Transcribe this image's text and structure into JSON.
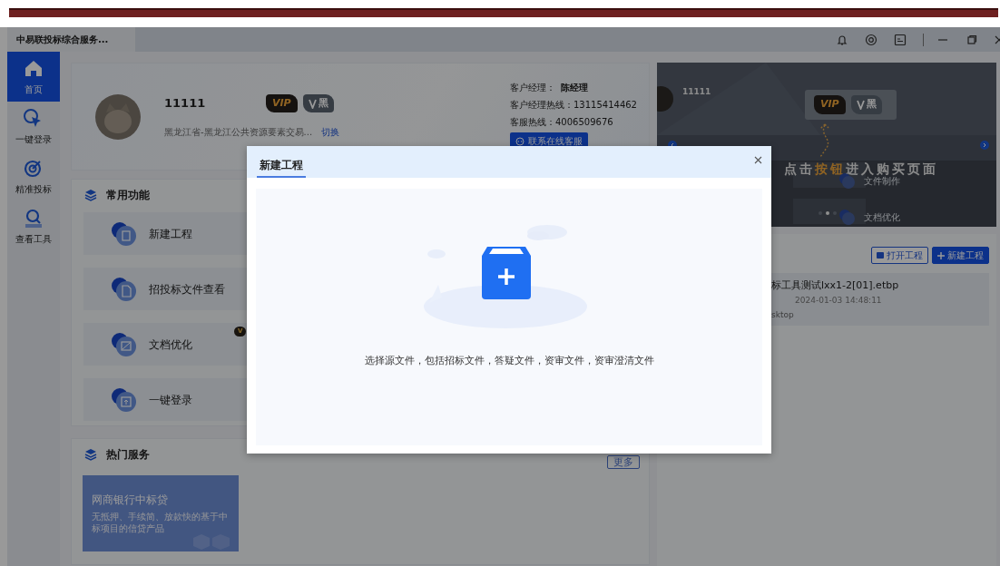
{
  "window": {
    "title": "中易联投标综合服务..."
  },
  "sidebar": {
    "items": [
      {
        "label": "首页",
        "selected": true,
        "kind": "home"
      },
      {
        "label": "一键登录",
        "selected": false,
        "kind": "login"
      },
      {
        "label": "精准投标",
        "selected": false,
        "kind": "target"
      },
      {
        "label": "查看工具",
        "selected": false,
        "kind": "search"
      }
    ]
  },
  "profile": {
    "name": "11111",
    "org": "黑龙江省-黑龙江公共资源要素交易...",
    "switch_link": "切换",
    "badges": [
      {
        "label": "VIP",
        "kind": "vip"
      },
      {
        "label": "黑",
        "kind": "level"
      }
    ],
    "manager_label": "客户经理：",
    "manager_name": "陈经理",
    "manager_hotline": "客户经理热线：13115414462",
    "service_hotline": "客服热线：4006509676",
    "chat_button": "联系在线客服"
  },
  "common": {
    "title": "常用功能",
    "items": [
      {
        "label": "新建工程",
        "kind": "project"
      },
      {
        "label": "招投标文件查看",
        "kind": "view"
      },
      {
        "label": "文档优化",
        "kind": "optimize",
        "badge": "V"
      },
      {
        "label": "一键登录",
        "kind": "login"
      }
    ]
  },
  "hot": {
    "title": "热门服务",
    "more": "更多",
    "promo": {
      "title": "网商银行中标贷",
      "text": "无抵押、手续简、放款快的基于中标项目的信贷产品"
    }
  },
  "banner": {
    "name": "11111",
    "badges": [
      {
        "label": "VIP",
        "kind": "vip"
      },
      {
        "label": "黑",
        "kind": "level"
      }
    ],
    "caption": [
      {
        "text": "点击",
        "highlight": false
      },
      {
        "text": "按钮",
        "highlight": true
      },
      {
        "text": "进入购买页面",
        "highlight": false
      }
    ],
    "items": [
      "文件制作",
      "文档优化"
    ],
    "slides": [
      {
        "selected": false
      },
      {
        "selected": true
      },
      {
        "selected": false
      }
    ]
  },
  "recent": {
    "buttons": [
      {
        "label": "打开工程",
        "kind": "outline"
      },
      {
        "label": "新建工程",
        "kind": "primary"
      }
    ],
    "files": [
      {
        "name": "标工具测试lxx1-2[01].etbp",
        "time": "2024-01-03 14:48:11",
        "path": "sktop"
      }
    ]
  },
  "dialog": {
    "tab": "新建工程",
    "hint": "选择源文件，包括招标文件，答疑文件，资审文件，资审澄清文件"
  }
}
